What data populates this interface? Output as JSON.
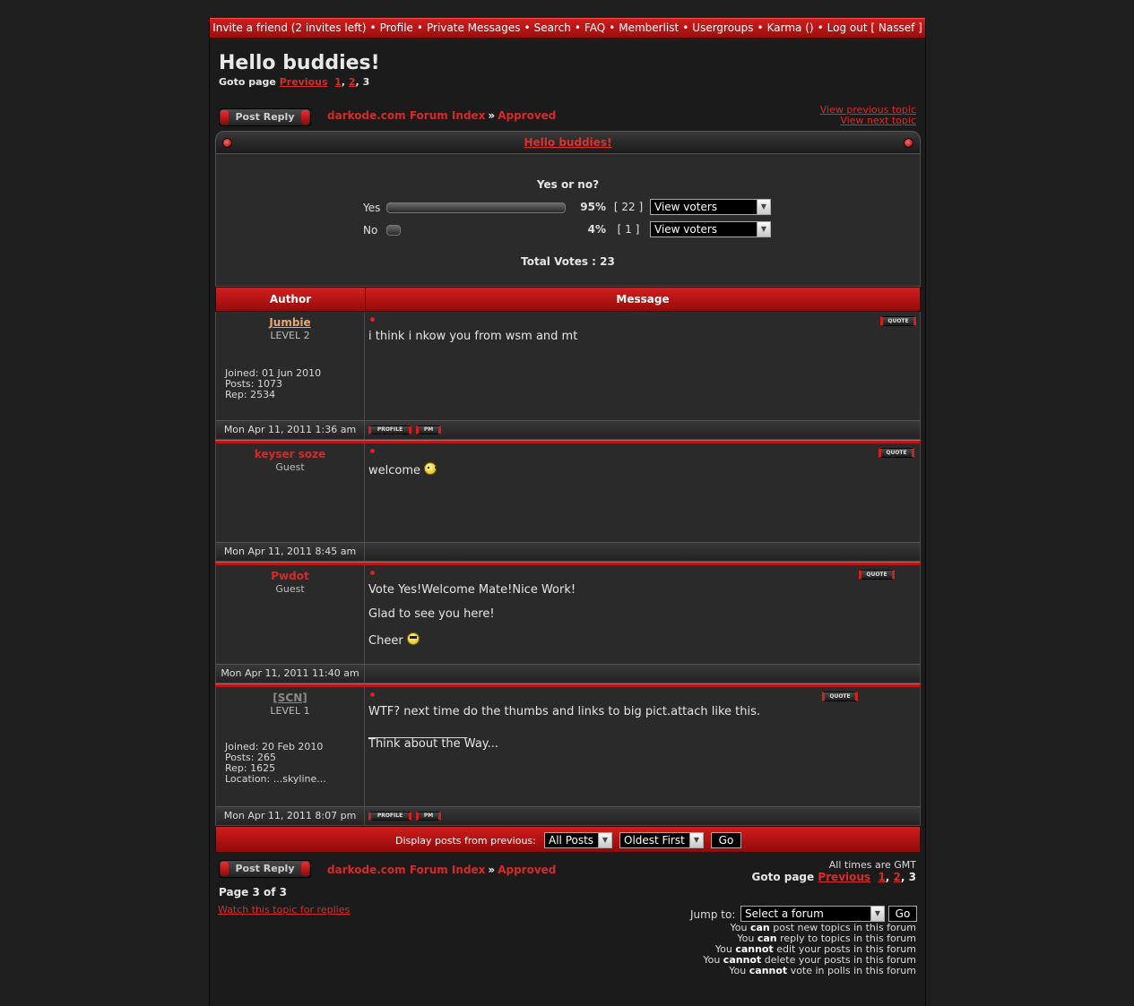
{
  "topnav": {
    "items": [
      "Invite a friend (2 invites left)",
      "Profile",
      "Private Messages",
      "Search",
      "FAQ",
      "Memberlist",
      "Usergroups",
      "Karma ()",
      "Log out [ Nassef ]"
    ],
    "separator": "•"
  },
  "topic": {
    "title": "Hello buddies!",
    "goto_label": "Goto page",
    "goto_prev": "Previous",
    "goto_p1": "1",
    "goto_p2": "2",
    "goto_current": "3",
    "post_reply": "Post Reply",
    "crumb_index": "darkode.com Forum Index",
    "crumb_sep": "»",
    "crumb_forum": "Approved",
    "view_previous": "View previous topic",
    "view_next": "View next topic"
  },
  "poll": {
    "question": "Yes or no?",
    "options": [
      {
        "label": "Yes",
        "percent": 95,
        "percent_text": "95%",
        "votes": "[ 22 ]",
        "select": "View voters"
      },
      {
        "label": "No",
        "percent": 4,
        "percent_text": "4%",
        "votes": "[ 1 ]",
        "select": "View voters"
      }
    ],
    "total": "Total Votes : 23"
  },
  "headers": {
    "author": "Author",
    "message": "Message"
  },
  "buttons": {
    "quote": "QUOTE",
    "profile": "PROFILE",
    "pm": "PM"
  },
  "posts": [
    {
      "name": "Jumbie",
      "name_color": "#e8a870",
      "level": "LEVEL 2",
      "info": [
        "Joined: 01 Jun 2010",
        "Posts: 1073",
        "Rep: 2534"
      ],
      "lines": [
        "i think i nkow you from wsm and mt"
      ],
      "date": "Mon Apr 11, 2011 1:36 am"
    },
    {
      "name": "keyser soze",
      "name_color": "#d62a2a",
      "level": "Guest",
      "info": [],
      "lines": [
        "welcome"
      ],
      "date": "Mon Apr 11, 2011 8:45 am"
    },
    {
      "name": "Pwdot",
      "name_color": "#d62a2a",
      "level": "Guest",
      "info": [],
      "lines": [
        "Vote Yes!Welcome Mate!Nice Work!",
        "Glad to see you here!",
        "Cheer"
      ],
      "date": "Mon Apr 11, 2011 11:40 am"
    },
    {
      "name": "[SCN]",
      "name_color": "#8a8a8a",
      "level": "LEVEL 1",
      "info": [
        "Joined: 20 Feb 2010",
        "Posts: 265",
        "Rep: 1625",
        "Location: ...skyline..."
      ],
      "lines": [
        "WTF? next time do the thumbs and links to big pict.attach like this.",
        "_________________",
        "Think about the Way..."
      ],
      "date": "Mon Apr 11, 2011 8:07 pm"
    }
  ],
  "display": {
    "label": "Display posts from previous:",
    "posts_select": "All Posts",
    "order_select": "Oldest First",
    "go": "Go"
  },
  "bottom": {
    "times": "All times are GMT",
    "page_of": "Page 3 of 3",
    "watch": "Watch this topic for replies",
    "jump_label": "Jump to:",
    "jump_select": "Select a forum",
    "jump_go": "Go"
  },
  "perms": {
    "you": "You",
    "lines": [
      {
        "verb": "can",
        "rest": "post new topics in this forum"
      },
      {
        "verb": "can",
        "rest": "reply to topics in this forum"
      },
      {
        "verb": "cannot",
        "rest": "edit your posts in this forum"
      },
      {
        "verb": "cannot",
        "rest": "delete your posts in this forum"
      },
      {
        "verb": "cannot",
        "rest": "vote in polls in this forum"
      }
    ]
  }
}
